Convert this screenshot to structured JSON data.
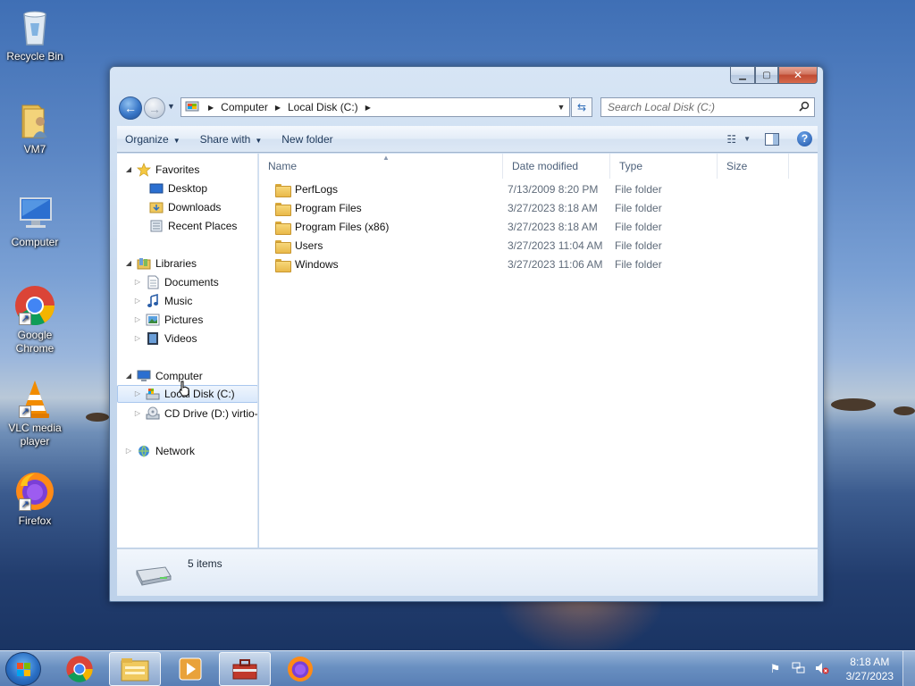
{
  "desktop": {
    "icons": [
      {
        "label": "Recycle Bin",
        "icon": "recycle-bin-icon"
      },
      {
        "label": "VM7",
        "icon": "user-folder-icon"
      },
      {
        "label": "Computer",
        "icon": "computer-icon"
      },
      {
        "label": "Google Chrome",
        "icon": "chrome-icon"
      },
      {
        "label": "VLC media player",
        "icon": "vlc-icon"
      },
      {
        "label": "Firefox",
        "icon": "firefox-icon"
      }
    ]
  },
  "window": {
    "breadcrumb": [
      "Computer",
      "Local Disk (C:)"
    ],
    "search_placeholder": "Search Local Disk (C:)",
    "toolbar": {
      "organize": "Organize",
      "share_with": "Share with",
      "new_folder": "New folder"
    },
    "nav": {
      "favorites": "Favorites",
      "desktop": "Desktop",
      "downloads": "Downloads",
      "recent_places": "Recent Places",
      "libraries": "Libraries",
      "documents": "Documents",
      "music": "Music",
      "pictures": "Pictures",
      "videos": "Videos",
      "computer": "Computer",
      "local_disk": "Local Disk (C:)",
      "cd_drive": "CD Drive (D:) virtio-win",
      "network": "Network"
    },
    "columns": {
      "name": "Name",
      "date": "Date modified",
      "type": "Type",
      "size": "Size"
    },
    "files": [
      {
        "name": "PerfLogs",
        "date": "7/13/2009 8:20 PM",
        "type": "File folder"
      },
      {
        "name": "Program Files",
        "date": "3/27/2023 8:18 AM",
        "type": "File folder"
      },
      {
        "name": "Program Files (x86)",
        "date": "3/27/2023 8:18 AM",
        "type": "File folder"
      },
      {
        "name": "Users",
        "date": "3/27/2023 11:04 AM",
        "type": "File folder"
      },
      {
        "name": "Windows",
        "date": "3/27/2023 11:06 AM",
        "type": "File folder"
      }
    ],
    "status": {
      "item_count": "5 items"
    }
  },
  "taskbar": {
    "clock_time": "8:18 AM",
    "clock_date": "3/27/2023"
  },
  "colors": {
    "accent": "#3a78c8",
    "selection": "#d9e8fb"
  }
}
